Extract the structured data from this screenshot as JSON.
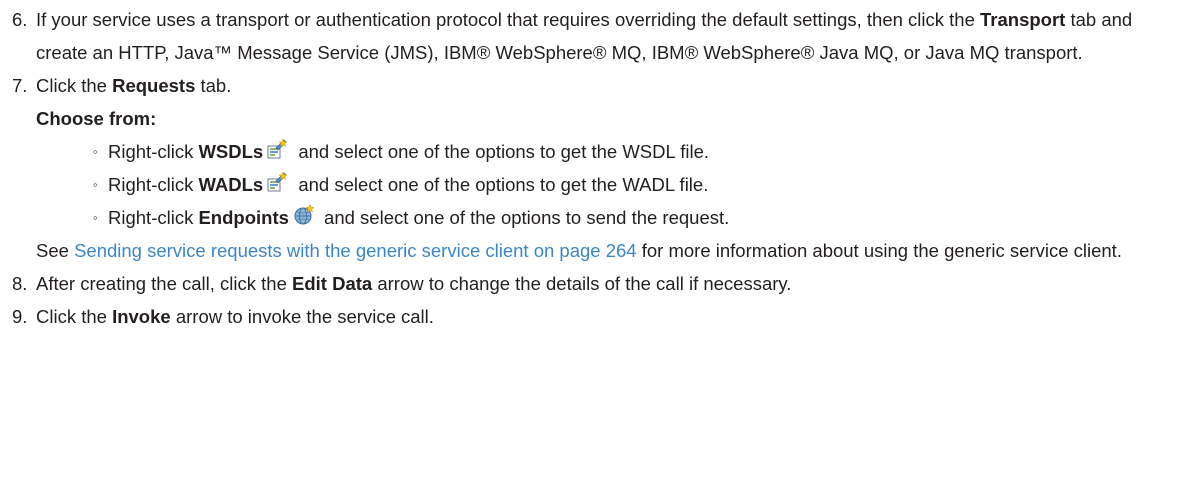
{
  "steps": [
    {
      "number": "6.",
      "text_before": "If your service uses a transport or authentication protocol that requires overriding the default settings, then click the ",
      "bold": "Transport",
      "text_after": " tab and create an HTTP, Java™ Message Service (JMS), IBM® WebSphere® MQ, IBM® WebSphere® Java MQ, or Java MQ transport."
    },
    {
      "number": "7.",
      "text_before": "Click the ",
      "bold": "Requests",
      "text_after": " tab.",
      "choose_from": "Choose from:",
      "options": [
        {
          "bullet": "◦",
          "prefix": "Right-click ",
          "bold": "WSDLs",
          "icon": "wsdl-icon",
          "suffix": " and select one of the options to get the WSDL file."
        },
        {
          "bullet": "◦",
          "prefix": "Right-click ",
          "bold": "WADLs",
          "icon": "wadl-icon",
          "suffix": " and select one of the options to get the WADL file."
        },
        {
          "bullet": "◦",
          "prefix": "Right-click ",
          "bold": "Endpoints",
          "icon": "endpoints-icon",
          "suffix": " and select one of the options to send the request."
        }
      ],
      "see_prefix": "See ",
      "see_link": "Sending service requests with the generic service client on page 264",
      "see_suffix": " for more information about using the generic service client."
    },
    {
      "number": "8.",
      "text_before": "After creating the call, click the ",
      "bold": "Edit Data",
      "text_after": " arrow to change the details of the call if necessary."
    },
    {
      "number": "9.",
      "text_before": "Click the ",
      "bold": "Invoke",
      "text_after": " arrow to invoke the service call."
    }
  ],
  "colors": {
    "text": "#231f20",
    "link": "#3b86c8"
  }
}
